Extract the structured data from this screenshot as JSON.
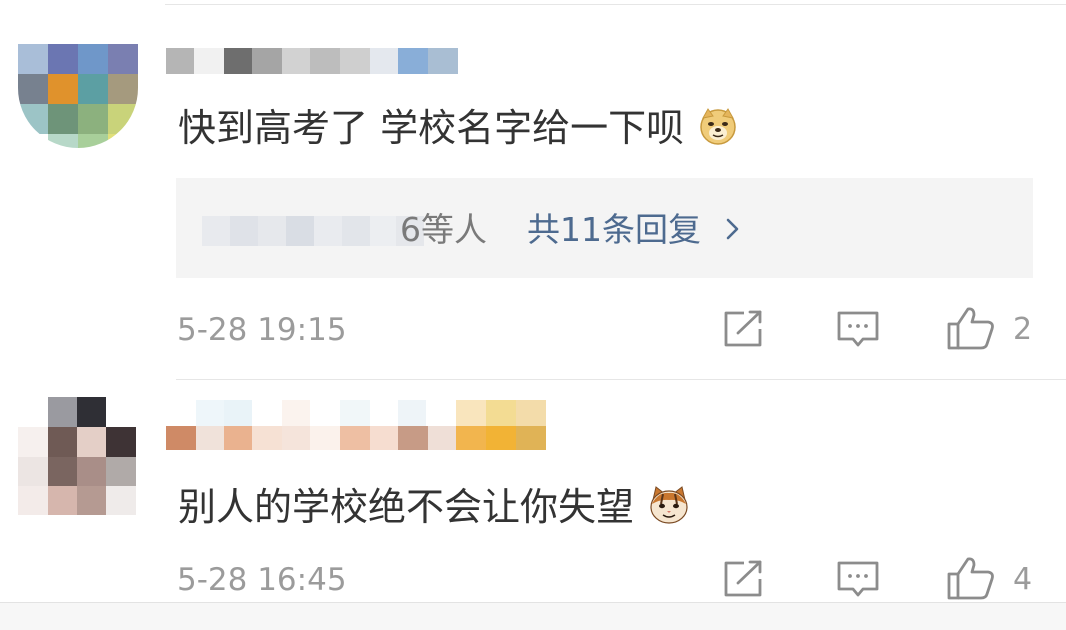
{
  "comments": [
    {
      "username": "",
      "text": "快到高考了 学校名字给一下呗",
      "emoji": "doge-emoji",
      "replies": {
        "who_suffix": "6等人",
        "count_label": "共11条回复"
      },
      "time": "5-28 19:15",
      "likes": "2"
    },
    {
      "username": "",
      "text": "别人的学校绝不会让你失望",
      "emoji": "cat-emoji",
      "time": "5-28 16:45",
      "likes": "4"
    }
  ],
  "colors": {
    "link": "#4d6a8f",
    "meta": "#9b9b9b",
    "body_text": "#333333",
    "reply_bg": "#f4f4f4"
  },
  "icons": [
    "edit-icon",
    "comment-icon",
    "thumbs-up-icon",
    "chevron-right-icon",
    "doge-emoji",
    "cat-emoji"
  ]
}
